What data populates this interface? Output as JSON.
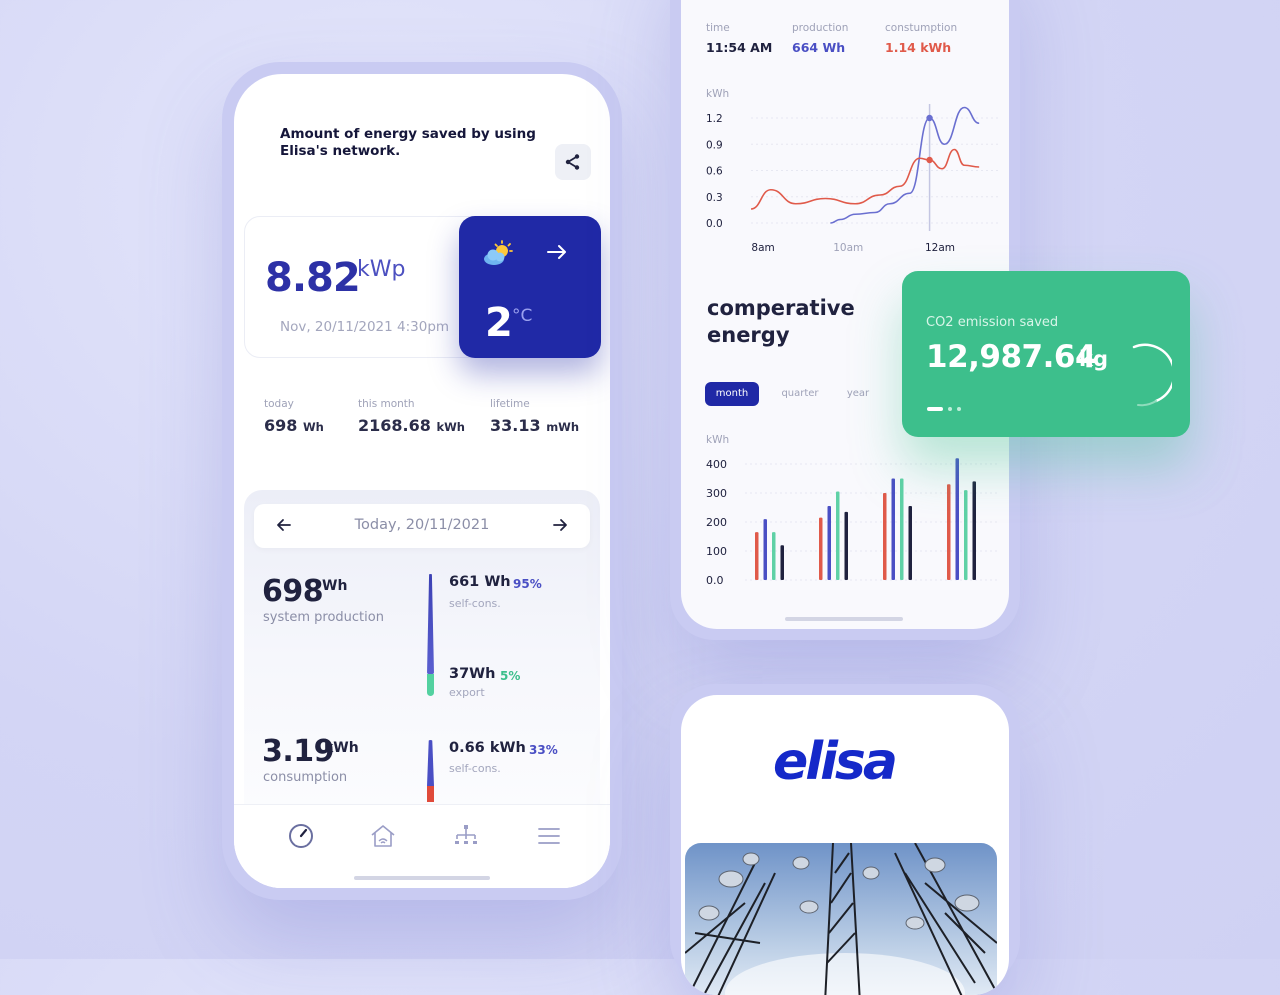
{
  "phone1": {
    "headline": "Amount of energy saved by using Elisa's network.",
    "power": {
      "value": "8.82",
      "unit": "kWp",
      "date": "Nov, 20/11/2021 4:30pm"
    },
    "weather": {
      "temp": "2",
      "unit": "°C",
      "icon": "partly-cloudy-icon"
    },
    "stats": [
      {
        "label": "today",
        "value": "698",
        "unit": "Wh"
      },
      {
        "label": "this month",
        "value": "2168.68",
        "unit": "kWh"
      },
      {
        "label": "lifetime",
        "value": "33.13",
        "unit": "mWh"
      }
    ],
    "date_nav": {
      "label": "Today,  20/11/2021"
    },
    "production": {
      "value": "698",
      "unit": "Wh",
      "label": "system production",
      "self_cons": {
        "value": "661 Wh",
        "pct": "95%",
        "label": "self-cons."
      },
      "export": {
        "value": "37Wh",
        "pct": "5%",
        "label": "export"
      }
    },
    "consumption": {
      "value": "3.19",
      "unit": "kWh",
      "label": "consumption",
      "self_cons": {
        "value": "0.66 kWh",
        "pct": "33%",
        "label": "self-cons."
      }
    },
    "tabs": [
      "gauge-icon",
      "house-icon",
      "network-icon",
      "menu-icon"
    ]
  },
  "phone2": {
    "header": {
      "time_label": "time",
      "time_value": "11:54 AM",
      "production_label": "production",
      "production_value": "664 Wh",
      "consumption_label": "constumption",
      "consumption_value": "1.14 kWh"
    },
    "comparative_title": "comperative energy",
    "segments": [
      "month",
      "quarter",
      "year"
    ]
  },
  "co2": {
    "label": "CO2 emission saved",
    "value": "12,987.64",
    "unit": "kg"
  },
  "phone3": {
    "logo_text": "elisa"
  },
  "colors": {
    "primary": "#2029a6",
    "green": "#3dbf8c",
    "red": "#e05a4a",
    "dark": "#20223f"
  },
  "chart_data": [
    {
      "type": "line",
      "ylabel": "kWh",
      "ylim": [
        0,
        1.2
      ],
      "yticks": [
        "1.2",
        "0.9",
        "0.6",
        "0.3",
        "0.0"
      ],
      "x_tick_labels": [
        "8am",
        "10am",
        "12am"
      ],
      "series": [
        {
          "name": "production",
          "color": "#6a6fd0",
          "points": [
            [
              0.32,
              0.0
            ],
            [
              0.36,
              0.04
            ],
            [
              0.42,
              0.1
            ],
            [
              0.5,
              0.12
            ],
            [
              0.56,
              0.22
            ],
            [
              0.64,
              0.34
            ],
            [
              0.72,
              1.2
            ],
            [
              0.78,
              0.9
            ],
            [
              0.86,
              1.32
            ],
            [
              0.92,
              1.14
            ]
          ]
        },
        {
          "name": "constumption",
          "color": "#e05a4a",
          "points": [
            [
              0.0,
              0.16
            ],
            [
              0.08,
              0.38
            ],
            [
              0.18,
              0.22
            ],
            [
              0.3,
              0.28
            ],
            [
              0.42,
              0.22
            ],
            [
              0.52,
              0.32
            ],
            [
              0.6,
              0.42
            ],
            [
              0.68,
              0.74
            ],
            [
              0.72,
              0.72
            ],
            [
              0.77,
              0.62
            ],
            [
              0.82,
              0.84
            ],
            [
              0.86,
              0.66
            ],
            [
              0.92,
              0.64
            ]
          ]
        }
      ]
    },
    {
      "type": "bar",
      "ylabel": "kWh",
      "ylim": [
        0,
        400
      ],
      "yticks": [
        "400",
        "300",
        "200",
        "100",
        "0.0"
      ],
      "categories": [
        "1",
        "2",
        "3",
        "4"
      ],
      "series": [
        {
          "name": "",
          "color": "#e05a4a",
          "values": [
            165,
            215,
            300,
            330
          ]
        },
        {
          "name": "",
          "color": "#4a4fc4",
          "values": [
            210,
            255,
            350,
            420
          ]
        },
        {
          "name": "",
          "color": "#5fd1a6",
          "values": [
            165,
            305,
            350,
            310
          ]
        },
        {
          "name": "",
          "color": "#20223f",
          "values": [
            120,
            235,
            255,
            340
          ]
        }
      ]
    }
  ]
}
